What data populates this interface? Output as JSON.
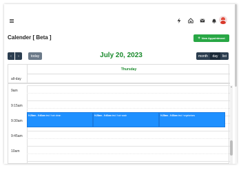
{
  "header": {
    "icons": [
      "hamburger-icon",
      "lightning-icon",
      "home-icon",
      "mail-icon",
      "bell-icon",
      "avatar"
    ]
  },
  "page": {
    "title": "Calender [ Beta ]",
    "new_appointment_label": "New Appointment"
  },
  "toolbar": {
    "prev_label": "‹",
    "next_label": "›",
    "today_label": "today",
    "title": "July 20, 2023",
    "views": [
      "month",
      "day",
      "list"
    ],
    "active_view": "day"
  },
  "calendar": {
    "day_header": "Thursday",
    "allday_label": "all-day",
    "times": [
      "9am",
      "9:15am",
      "9:30am",
      "9:45am",
      "10am"
    ],
    "events": [
      {
        "time": "9:25am - 9:40am",
        "title": "test / hair clean"
      },
      {
        "time": "9:25am - 9:40am",
        "title": "test / hair wash"
      },
      {
        "time": "9:25am - 9:35am",
        "title": "test / vegetarians"
      }
    ]
  },
  "colors": {
    "accent_green": "#1a8a2c",
    "button_green": "#28a745",
    "event_blue": "#1e90ff",
    "button_dark": "#2c3e50"
  }
}
